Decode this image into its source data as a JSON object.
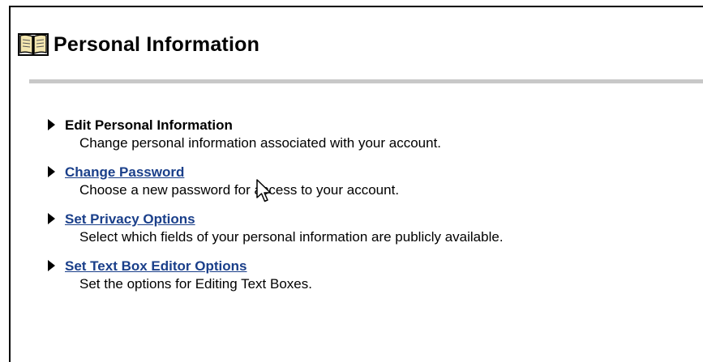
{
  "page": {
    "title": "Personal Information",
    "icon": "book-icon"
  },
  "options": [
    {
      "title": "Edit Personal Information",
      "description": "Change personal information associated with your account.",
      "is_link": false
    },
    {
      "title": "Change Password",
      "description": "Choose a new password for access to your account.",
      "is_link": true
    },
    {
      "title": "Set Privacy Options",
      "description": "Select which fields of your personal information are publicly available.",
      "is_link": true
    },
    {
      "title": "Set Text Box Editor Options",
      "description": "Set the options for Editing Text Boxes.",
      "is_link": true
    }
  ],
  "colors": {
    "link": "#1a3f8a",
    "divider": "#c8c8c8",
    "text": "#000000"
  }
}
